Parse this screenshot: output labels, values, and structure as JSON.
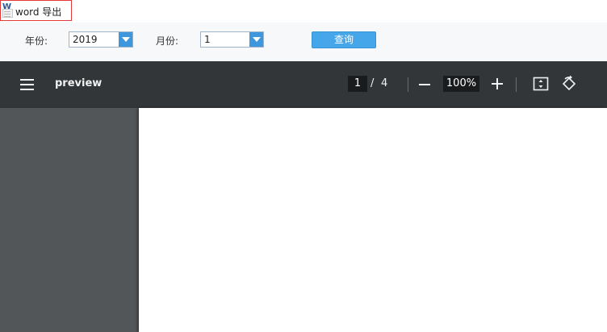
{
  "tab": {
    "label": "word 导出",
    "icon": "word-document-icon"
  },
  "filters": {
    "year_label": "年份:",
    "year_value": "2019",
    "month_label": "月份:",
    "month_value": "1",
    "query_label": "查询"
  },
  "viewer": {
    "title": "preview",
    "current_page": "1",
    "page_separator": "/",
    "total_pages": "4",
    "zoom": "100%",
    "colors": {
      "toolbar": "#323639",
      "sidebar": "#525659",
      "accent": "#45a6ea"
    },
    "icons": [
      "menu-icon",
      "zoom-out-icon",
      "zoom-in-icon",
      "fit-page-icon",
      "rotate-icon"
    ]
  }
}
